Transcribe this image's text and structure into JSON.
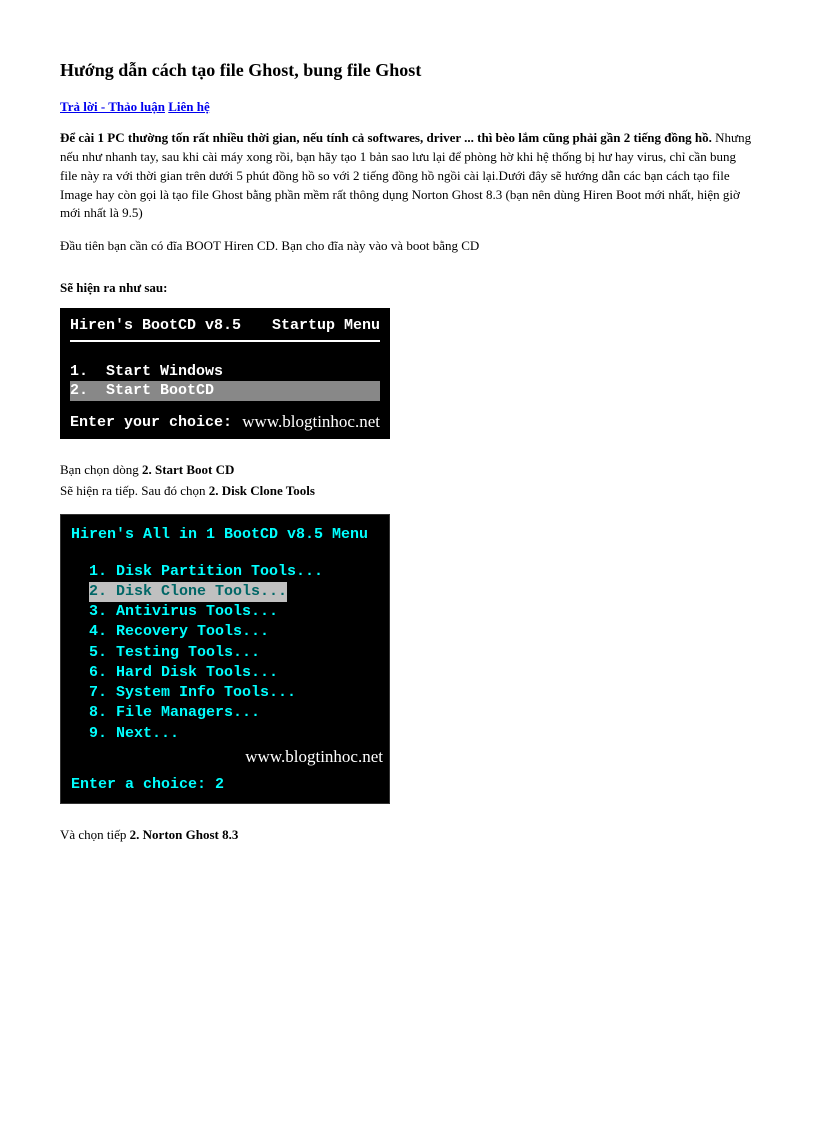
{
  "title": "Hướng dẫn cách tạo file Ghost, bung file Ghost",
  "links": {
    "reply": "Trả lời - Thảo luận",
    "contact": "Liên hệ"
  },
  "intro_bold": "Để cài 1 PC thường tốn rất nhiều thời gian, nếu tính cả softwares, driver ... thì bèo lắm cũng phải gần 2 tiếng đồng hồ.",
  "intro_rest": " Nhưng nếu như nhanh tay, sau khi cài máy xong rồi, bạn hãy tạo 1 bản sao lưu lại để phòng hờ khi hệ thống bị hư hay virus, chỉ cần bung file này ra với thời gian trên dưới 5 phút đồng hồ so với 2 tiếng đồng hồ ngồi cài lại.Dưới đây sẽ hướng dẫn các bạn cách tạo file Image hay còn gọi là tạo file Ghost bằng phần mềm rất thông dụng Norton Ghost 8.3 (bạn nên dùng Hiren Boot mới nhất, hiện giờ mới nhất là 9.5)",
  "para_boot": "Đầu tiên bạn cần có đĩa BOOT Hiren CD. Bạn cho đĩa này vào và boot bằng CD",
  "section1": "Sẽ hiện ra như sau:",
  "term1": {
    "title_left": "Hiren's BootCD v8.5",
    "title_right": "Startup Menu",
    "item1": "1.  Start Windows",
    "item2": "2.  Start BootCD",
    "enter": "Enter your choice:",
    "watermark": "www.blogtinhoc.net"
  },
  "after1_a": "Bạn chọn dòng ",
  "after1_a_bold": "2. Start Boot CD",
  "after1_b": "Sẽ hiện ra tiếp. Sau đó chọn ",
  "after1_b_bold": "2. Disk Clone Tools",
  "term2": {
    "title": "Hiren's All in 1 BootCD v8.5 Menu",
    "items": [
      "1. Disk Partition Tools...",
      "2. Disk Clone Tools...",
      "3. Antivirus Tools...",
      "4. Recovery Tools...",
      "5. Testing Tools...",
      "6. Hard Disk Tools...",
      "7. System Info Tools...",
      "8. File Managers...",
      "9. Next..."
    ],
    "watermark": "www.blogtinhoc.net",
    "prompt": "Enter a choice: 2"
  },
  "after2_a": "Và chọn tiếp ",
  "after2_a_bold": "2. Norton Ghost 8.3"
}
